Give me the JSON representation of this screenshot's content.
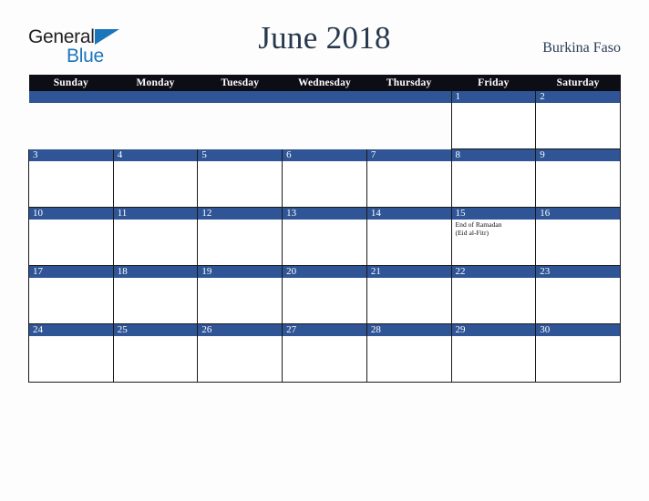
{
  "brand": {
    "name_top": "General",
    "name_bottom": "Blue",
    "triangle_icon": "blue-triangle-icon",
    "accent_color": "#1b75bb",
    "text_color": "#231f20"
  },
  "header": {
    "title": "June 2018",
    "country": "Burkina Faso",
    "title_color": "#26374e"
  },
  "calendar": {
    "weekday_headers": [
      "Sunday",
      "Monday",
      "Tuesday",
      "Wednesday",
      "Thursday",
      "Friday",
      "Saturday"
    ],
    "header_bg": "#0d0d15",
    "daynum_bg": "#2f5596",
    "cell_bg": "#ffffff",
    "weeks": [
      [
        {
          "day": "",
          "events": []
        },
        {
          "day": "",
          "events": []
        },
        {
          "day": "",
          "events": []
        },
        {
          "day": "",
          "events": []
        },
        {
          "day": "",
          "events": []
        },
        {
          "day": "1",
          "events": []
        },
        {
          "day": "2",
          "events": []
        }
      ],
      [
        {
          "day": "3",
          "events": []
        },
        {
          "day": "4",
          "events": []
        },
        {
          "day": "5",
          "events": []
        },
        {
          "day": "6",
          "events": []
        },
        {
          "day": "7",
          "events": []
        },
        {
          "day": "8",
          "events": []
        },
        {
          "day": "9",
          "events": []
        }
      ],
      [
        {
          "day": "10",
          "events": []
        },
        {
          "day": "11",
          "events": []
        },
        {
          "day": "12",
          "events": []
        },
        {
          "day": "13",
          "events": []
        },
        {
          "day": "14",
          "events": []
        },
        {
          "day": "15",
          "events": [
            "End of Ramadan",
            "(Eid al-Fitr)"
          ]
        },
        {
          "day": "16",
          "events": []
        }
      ],
      [
        {
          "day": "17",
          "events": []
        },
        {
          "day": "18",
          "events": []
        },
        {
          "day": "19",
          "events": []
        },
        {
          "day": "20",
          "events": []
        },
        {
          "day": "21",
          "events": []
        },
        {
          "day": "22",
          "events": []
        },
        {
          "day": "23",
          "events": []
        }
      ],
      [
        {
          "day": "24",
          "events": []
        },
        {
          "day": "25",
          "events": []
        },
        {
          "day": "26",
          "events": []
        },
        {
          "day": "27",
          "events": []
        },
        {
          "day": "28",
          "events": []
        },
        {
          "day": "29",
          "events": []
        },
        {
          "day": "30",
          "events": []
        }
      ]
    ]
  }
}
